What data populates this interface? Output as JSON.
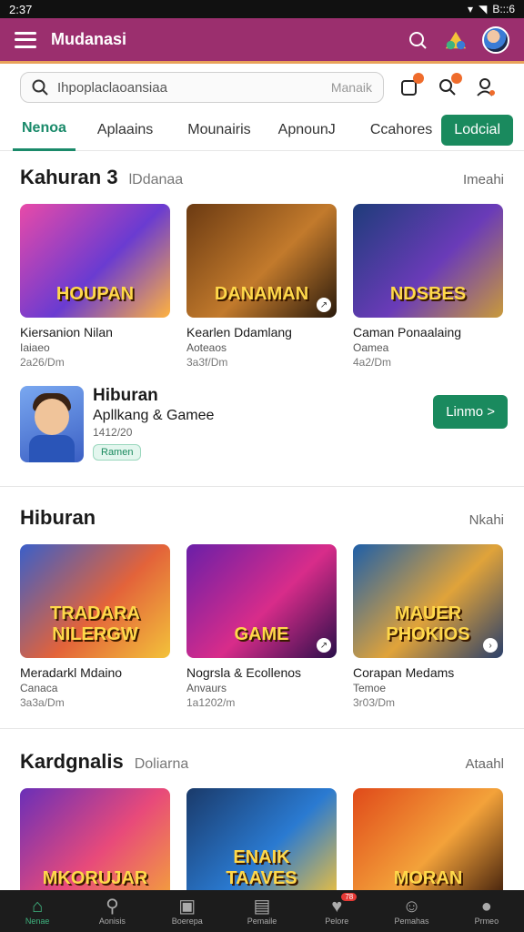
{
  "status_bar": {
    "time": "2:37",
    "battery": "B:::6"
  },
  "app_bar": {
    "title": "Mudanasi"
  },
  "search": {
    "placeholder": "Ihpoplaclaoansiaa",
    "hint": "Manaik"
  },
  "tabs": [
    {
      "label": "Nenoa",
      "active": true
    },
    {
      "label": "Aplaains",
      "active": false
    },
    {
      "label": "Mounairis",
      "active": false
    },
    {
      "label": "ApnounJ",
      "active": false
    },
    {
      "label": "Ccahores",
      "active": false
    }
  ],
  "tab_button": "Lodcial",
  "section1": {
    "title": "Kahuran 3",
    "subtitle": "lDdanaa",
    "more": "Imeahi",
    "cards": [
      {
        "title": "Kiersanion Nilan",
        "sub": "Iaiaeo",
        "meta": "2a26/Dm",
        "art": "HOUPAN",
        "colors": [
          "#e84aa8",
          "#6a3bd1",
          "#ffb23f"
        ]
      },
      {
        "title": "Kearlen Ddamlang",
        "sub": "Aoteaos",
        "meta": "3a3f/Dm",
        "art": "DANAMAN",
        "colors": [
          "#6b3a12",
          "#c27a2c",
          "#2a1a0c"
        ]
      },
      {
        "title": "Caman Ponaalaing",
        "sub": "Oamea",
        "meta": "4a2/Dm",
        "art": "NDSBES",
        "colors": [
          "#1e3c7a",
          "#6a3bb8",
          "#c99a3a"
        ]
      }
    ]
  },
  "promo": {
    "title": "Hiburan",
    "subtitle": "Apllkang & Gamee",
    "meta": "1412/20",
    "chip": "Ramen",
    "button": "Linmo >"
  },
  "section2": {
    "title": "Hiburan",
    "subtitle": "",
    "more": "Nkahi",
    "cards": [
      {
        "title": "Meradarkl Mdaino",
        "sub": "Canaca",
        "meta": "3a3a/Dm",
        "art": "TRADARA NILERGW",
        "colors": [
          "#3a5fc9",
          "#e3633a",
          "#f3c23a"
        ]
      },
      {
        "title": "Nogrsla & Ecollenos",
        "sub": "Anvaurs",
        "meta": "1a1202/m",
        "art": "GAME",
        "colors": [
          "#6a1fa8",
          "#d82c8a",
          "#2a0f4a"
        ]
      },
      {
        "title": "Corapan Medams",
        "sub": "Temoe",
        "meta": "3r03/Dm",
        "art": "MAUER PHOKIOS",
        "colors": [
          "#1e5fa8",
          "#e0a33a",
          "#2a3f6a"
        ]
      }
    ]
  },
  "section3": {
    "title": "Kardgnalis",
    "subtitle": "Doliarna",
    "more": "Ataahl",
    "cards": [
      {
        "title": "",
        "sub": "",
        "meta": "",
        "art": "MKORUJAR",
        "colors": [
          "#6a2fb8",
          "#e84a7a",
          "#f3a23a"
        ]
      },
      {
        "title": "",
        "sub": "",
        "meta": "",
        "art": "ENAIK TAAVES",
        "colors": [
          "#1a3a6a",
          "#2a7ad1",
          "#f3c23a"
        ]
      },
      {
        "title": "",
        "sub": "",
        "meta": "",
        "art": "MORAN",
        "colors": [
          "#e04a1a",
          "#f3a23a",
          "#3a1a0a"
        ]
      }
    ]
  },
  "bottom_nav": [
    {
      "label": "Nenae",
      "icon": "home-icon",
      "active": true
    },
    {
      "label": "Aonisis",
      "icon": "search-icon",
      "active": false
    },
    {
      "label": "Boerepa",
      "icon": "library-icon",
      "active": false
    },
    {
      "label": "Pemaile",
      "icon": "bookmark-icon",
      "active": false
    },
    {
      "label": "Pelore",
      "icon": "heart-icon",
      "active": false,
      "badge": "78"
    },
    {
      "label": "Pemahas",
      "icon": "user-icon",
      "active": false
    },
    {
      "label": "Prmeo",
      "icon": "profile-icon",
      "active": false
    }
  ]
}
